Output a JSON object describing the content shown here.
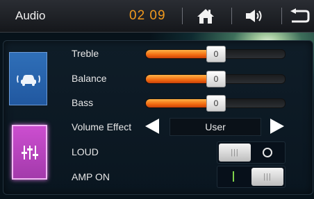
{
  "header": {
    "title": "Audio",
    "time": "02 09"
  },
  "icons": {
    "home": "home-icon",
    "volume": "speaker-icon",
    "back": "back-icon"
  },
  "sidebar": {
    "tabs": [
      {
        "name": "car-surround-tab",
        "icon": "car-icon",
        "selected": false
      },
      {
        "name": "equalizer-tab",
        "icon": "equalizer-icon",
        "selected": true
      }
    ]
  },
  "settings": {
    "treble": {
      "label": "Treble",
      "value": "0",
      "fill": 0.5
    },
    "balance": {
      "label": "Balance",
      "value": "0",
      "fill": 0.5
    },
    "bass": {
      "label": "Bass",
      "value": "0",
      "fill": 0.5
    },
    "volume_effect": {
      "label": "Volume Effect",
      "value": "User"
    },
    "loud": {
      "label": "LOUD",
      "state": "off"
    },
    "amp_on": {
      "label": "AMP ON",
      "state": "on"
    }
  },
  "colors": {
    "accent_orange": "#f29a1e",
    "eq_tab_magenta": "#c447c9",
    "car_tab_blue": "#2a64ad",
    "toggle_on_green": "#7fd24a"
  }
}
